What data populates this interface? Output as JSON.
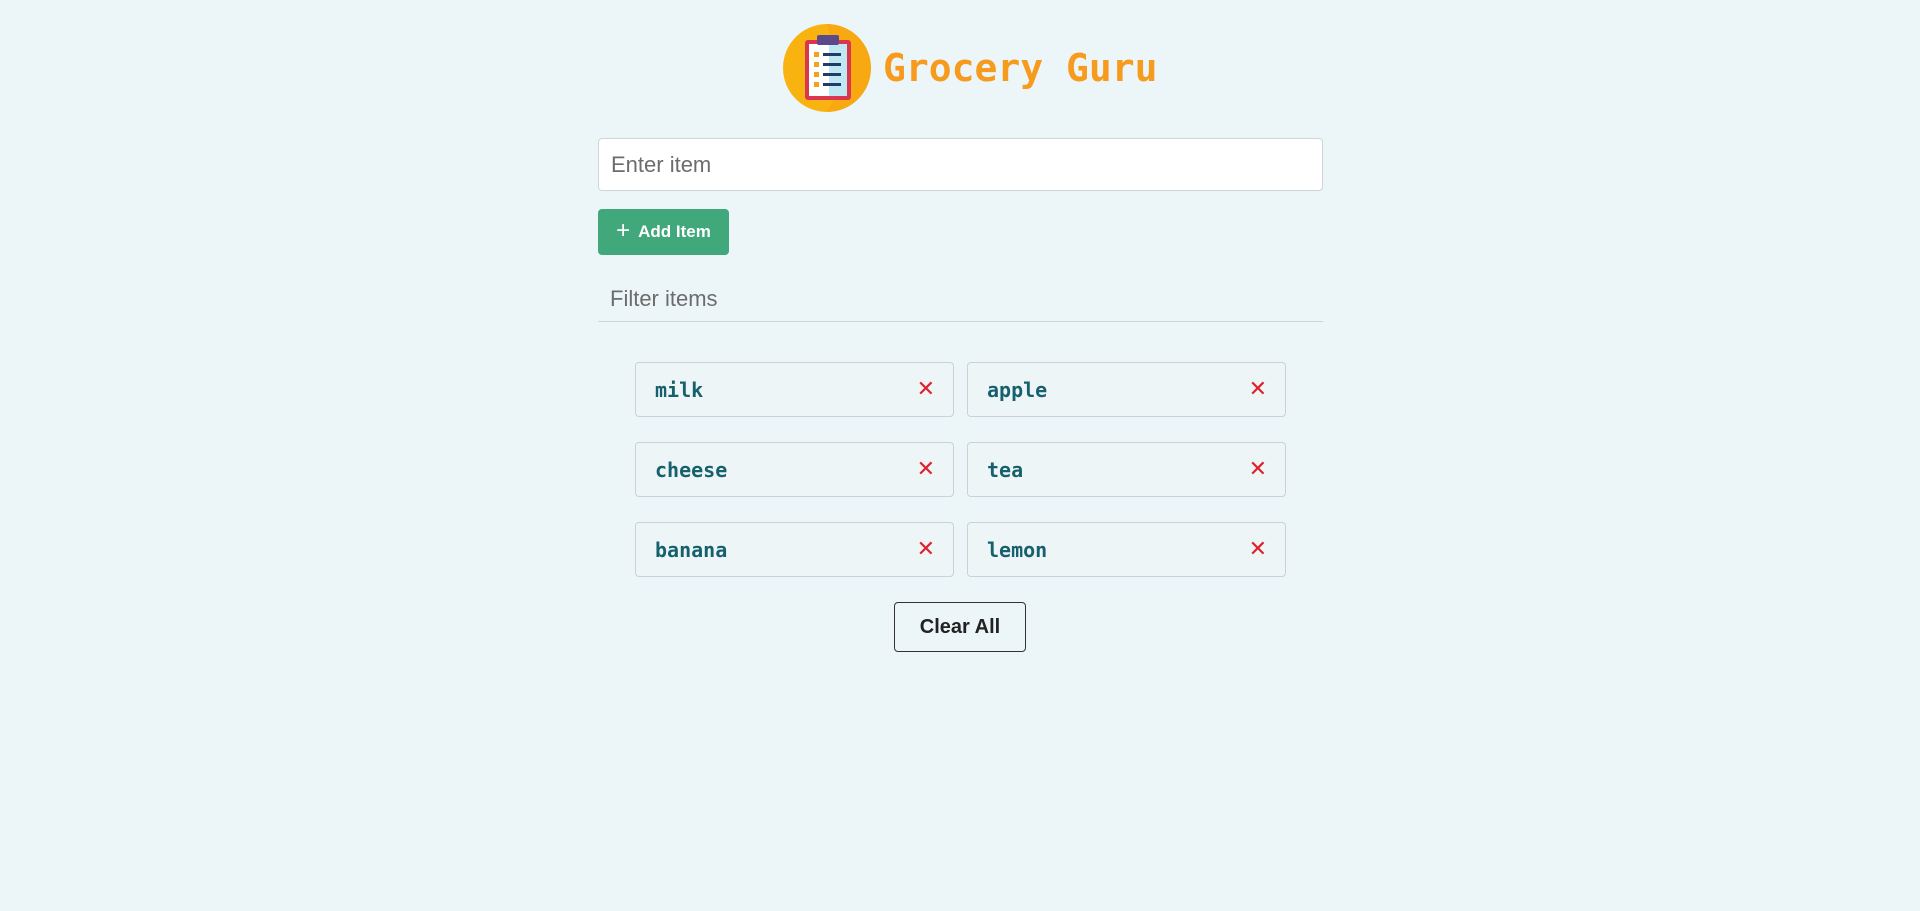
{
  "app": {
    "title": "Grocery Guru",
    "logo_icon": "clipboard-checklist-icon",
    "accent_color": "#f79b1f"
  },
  "item_form": {
    "placeholder": "Enter item",
    "value": "",
    "add_button_label": "Add Item",
    "add_button_icon": "plus-icon",
    "add_button_color": "#40a87a"
  },
  "filter": {
    "placeholder": "Filter items",
    "value": ""
  },
  "items": [
    {
      "name": "milk",
      "remove_icon": "close-icon"
    },
    {
      "name": "apple",
      "remove_icon": "close-icon"
    },
    {
      "name": "cheese",
      "remove_icon": "close-icon"
    },
    {
      "name": "tea",
      "remove_icon": "close-icon"
    },
    {
      "name": "banana",
      "remove_icon": "close-icon"
    },
    {
      "name": "lemon",
      "remove_icon": "close-icon"
    }
  ],
  "clear_button_label": "Clear All"
}
